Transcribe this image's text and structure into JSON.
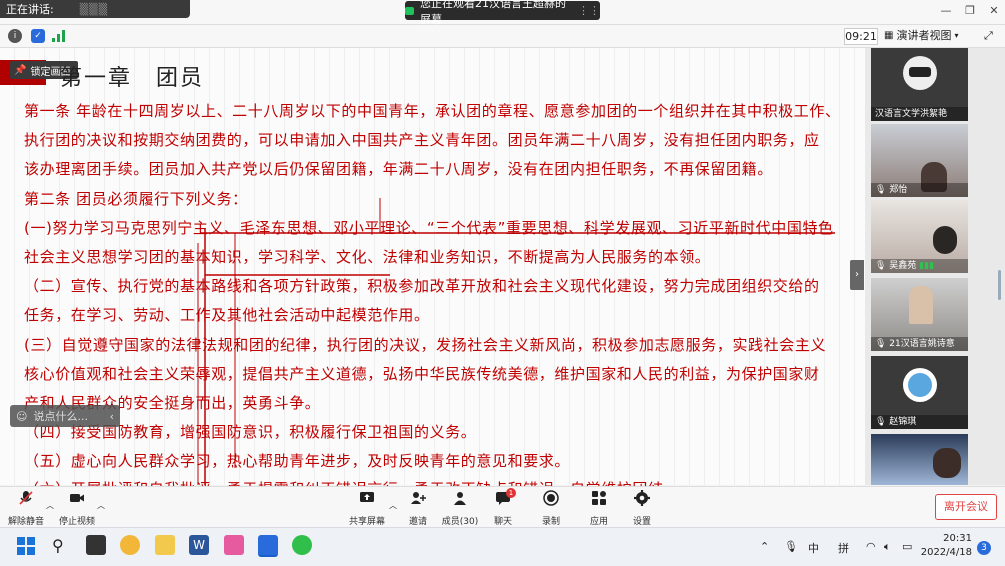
{
  "top": {
    "speaking_label": "正在讲话:",
    "share_banner": "您正在观看21汉语言王超赫的屏幕"
  },
  "toolbar": {
    "timer": "09:21",
    "presenter_view": "演讲者视图"
  },
  "document": {
    "lock_label": "锁定画面",
    "chapter": "第一章　团员",
    "lines": [
      "第一条 年龄在十四周岁以上、二十八周岁以下的中国青年，承认团的章程、愿意参加团的一个组织并在其中积极工作、",
      "执行团的决议和按期交纳团费的，可以申请加入中国共产主义青年团。团员年满二十八周岁，没有担任团内职务，应",
      "该办理离团手续。团员加入共产党以后仍保留团籍，年满二十八周岁，没有在团内担任职务，不再保留团籍。",
      "第二条 团员必须履行下列义务：",
      "(一)努力学习马克思列宁主义、毛泽东思想、邓小平理论、“三个代表”重要思想、科学发展观、习近平新时代中国特色",
      "社会主义思想学习团的基本知识，学习科学、文化、法律和业务知识，不断提高为人民服务的本领。",
      "（二）宣传、执行党的基本路线和各项方针政策，积极参加改革开放和社会主义现代化建设，努力完成团组织交给的",
      "任务，在学习、劳动、工作及其他社会活动中起模范作用。",
      "(三）自觉遵守国家的法律法规和团的纪律，执行团的决议，发扬社会主义新风尚，积极参加志愿服务，实践社会主义",
      "核心价值观和社会主义荣辱观，提倡共产主义道德，弘扬中华民族传统美德，维护国家和人民的利益，为保护国家财",
      "产和人民群众的安全挺身而出，英勇斗争。",
      "（四）接受国防教育，增强国防意识，积极履行保卫祖国的义务。",
      "（五）虚心向人民群众学习，热心帮助青年进步，及时反映青年的意见和要求。",
      "（六）开展批评和自我批评，勇于揭露和纠正错误言行，勇于改正缺点和错误，自觉维护团结。"
    ],
    "comment_placeholder": "说点什么..."
  },
  "participants": [
    {
      "name": "汉语言文学洪絮艳",
      "icon": "avatar-mask"
    },
    {
      "name": "郑怡",
      "icon": "video"
    },
    {
      "name": "吴鑫苑",
      "icon": "video"
    },
    {
      "name": "21汉语言姚诗意",
      "icon": "video"
    },
    {
      "name": "赵锦琪",
      "icon": "avatar-doraemon"
    },
    {
      "name": "",
      "icon": "video"
    }
  ],
  "controls": {
    "unmute": "解除静音",
    "stop_video": "停止视频",
    "share_screen": "共享屏幕",
    "invite": "邀请",
    "members": "成员(30)",
    "chat": "聊天",
    "chat_badge": "1",
    "record": "录制",
    "apps": "应用",
    "settings": "设置",
    "leave": "离开会议"
  },
  "taskbar": {
    "ime_lang": "中",
    "ime_mode": "拼",
    "time": "20:31",
    "date": "2022/4/18",
    "notifications": "3"
  }
}
